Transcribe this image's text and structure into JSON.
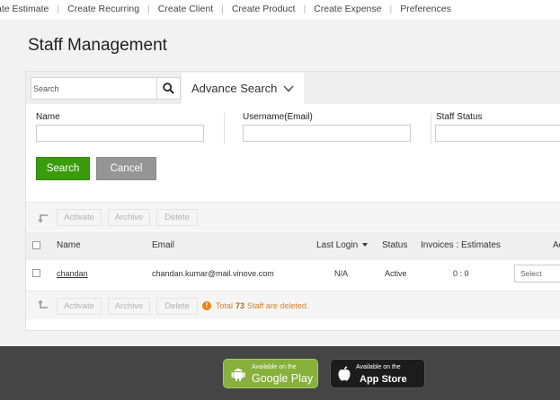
{
  "top_nav": {
    "items": [
      "ate Estimate",
      "Create Recurring",
      "Create Client",
      "Create Product",
      "Create Expense",
      "Preferences"
    ],
    "separator": "|"
  },
  "page_title": "Staff Management",
  "search": {
    "placeholder": "Search",
    "value": "",
    "advance_search_label": "Advance Search"
  },
  "filters": {
    "name_label": "Name",
    "name_value": "",
    "username_label": "Username(Email)",
    "username_value": "",
    "status_label": "Staff Status",
    "status_value": ""
  },
  "buttons": {
    "search": "Search",
    "cancel": "Cancel"
  },
  "bulk_actions": {
    "activate": "Activate",
    "archive": "Archive",
    "delete": "Delete"
  },
  "table": {
    "columns": {
      "name": "Name",
      "email": "Email",
      "last_login": "Last Login",
      "status": "Status",
      "invoices_estimates": "Invoices : Estimates",
      "actions": "Ac"
    },
    "rows": [
      {
        "name": "chandan",
        "email": "chandan.kumar@mail.vinove.com",
        "last_login": "N/A",
        "status": "Active",
        "invoices_estimates": "0 : 0",
        "action_placeholder": "Select"
      }
    ]
  },
  "deleted_note": {
    "prefix": "Total",
    "count": "73",
    "suffix": "Staff are deleted."
  },
  "footer": {
    "google_play": {
      "small": "Available on the",
      "big": "Google Play"
    },
    "app_store": {
      "small": "Available on the",
      "big": "App Store"
    }
  },
  "colors": {
    "search_button": "#3a9c0a",
    "cancel_button": "#959595",
    "warning": "#e8830f",
    "footer_bg": "#454545",
    "google_badge": "#87b03c"
  }
}
